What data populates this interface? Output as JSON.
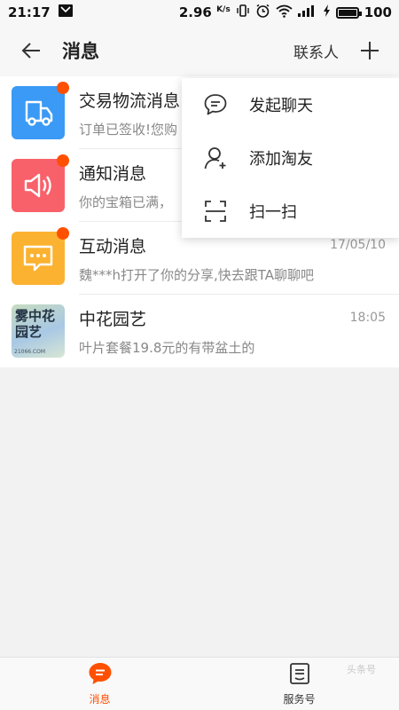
{
  "status_bar": {
    "time": "21:17",
    "speed": "2.96",
    "speed_unit": "K/s",
    "battery": "100"
  },
  "header": {
    "title": "消息",
    "contacts_label": "联系人"
  },
  "messages": [
    {
      "title": "交易物流消息",
      "time": "",
      "preview": "订单已签收!您购",
      "icon": "truck-icon",
      "icon_color": "#3a9af5",
      "unread": true
    },
    {
      "title": "通知消息",
      "time": "",
      "preview": "你的宝箱已满，",
      "icon": "speaker-icon",
      "icon_color": "#f8616a",
      "unread": true
    },
    {
      "title": "互动消息",
      "time": "17/05/10",
      "preview": "魏***h打开了你的分享,快去跟TA聊聊吧",
      "icon": "chat-dots-icon",
      "icon_color": "#fbb231",
      "unread": true
    },
    {
      "title": "中花园艺",
      "time": "18:05",
      "preview": "叶片套餐19.8元的有带盆土的",
      "icon": "shop-avatar",
      "avatar_text": "雾中花园艺",
      "avatar_site": "21066.COM",
      "unread": false
    }
  ],
  "dropdown": {
    "items": [
      {
        "label": "发起聊天",
        "icon": "chat-bubble-icon"
      },
      {
        "label": "添加淘友",
        "icon": "add-friend-icon"
      },
      {
        "label": "扫一扫",
        "icon": "scan-icon"
      }
    ]
  },
  "bottom_nav": {
    "tabs": [
      {
        "label": "消息",
        "icon": "message-icon",
        "active": true
      },
      {
        "label": "服务号",
        "icon": "service-icon",
        "active": false
      }
    ],
    "watermark": "头条号"
  },
  "colors": {
    "accent": "#ff5000",
    "background": "#f2f2f2"
  }
}
